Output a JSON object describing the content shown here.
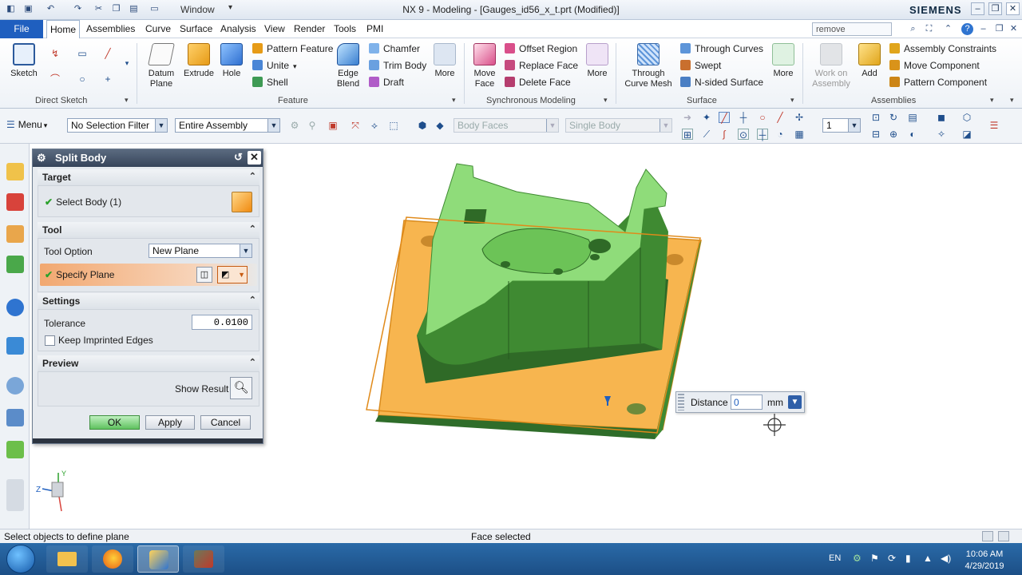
{
  "window": {
    "title": "NX 9 - Modeling - [Gauges_id56_x_t.prt (Modified)]",
    "brand": "SIEMENS",
    "window_menu": "Window",
    "search_value": "remove"
  },
  "menu": {
    "file": "File",
    "tabs": [
      "Home",
      "Assemblies",
      "Curve",
      "Surface",
      "Analysis",
      "View",
      "Render",
      "Tools",
      "PMI"
    ]
  },
  "ribbon": {
    "direct_sketch": {
      "label": "Direct Sketch",
      "sketch": "Sketch"
    },
    "feature": {
      "label": "Feature",
      "datum_plane": "Datum Plane",
      "extrude": "Extrude",
      "hole": "Hole",
      "pattern_feature": "Pattern Feature",
      "unite": "Unite",
      "shell": "Shell",
      "edge_blend": "Edge Blend",
      "chamfer": "Chamfer",
      "trim_body": "Trim Body",
      "draft": "Draft",
      "more": "More"
    },
    "sync": {
      "label": "Synchronous Modeling",
      "move_face": "Move Face",
      "offset_region": "Offset Region",
      "replace_face": "Replace Face",
      "delete_face": "Delete Face",
      "more": "More"
    },
    "surface": {
      "label": "Surface",
      "through_curve_mesh": "Through Curve Mesh",
      "through_curves": "Through Curves",
      "swept": "Swept",
      "n_sided_surface": "N-sided Surface",
      "more": "More"
    },
    "assemblies": {
      "label": "Assemblies",
      "work_on_assembly": "Work on Assembly",
      "add": "Add",
      "assembly_constraints": "Assembly Constraints",
      "move_component": "Move Component",
      "pattern_component": "Pattern Component"
    }
  },
  "toolbar": {
    "menu": "Menu",
    "selection_filter": "No Selection Filter",
    "scope": "Entire Assembly",
    "body_faces": "Body Faces",
    "single_body": "Single Body",
    "layer": "1"
  },
  "dialog": {
    "title": "Split Body",
    "target": {
      "header": "Target",
      "select_body": "Select Body (1)"
    },
    "tool": {
      "header": "Tool",
      "tool_option_label": "Tool Option",
      "tool_option_value": "New Plane",
      "specify_plane": "Specify Plane"
    },
    "settings": {
      "header": "Settings",
      "tolerance_label": "Tolerance",
      "tolerance_value": "0.0100",
      "keep_imprinted": "Keep Imprinted Edges"
    },
    "preview": {
      "header": "Preview",
      "show_result": "Show Result"
    },
    "buttons": {
      "ok": "OK",
      "apply": "Apply",
      "cancel": "Cancel"
    }
  },
  "distance_popup": {
    "label": "Distance",
    "value": "0",
    "unit": "mm"
  },
  "triad": {
    "z": "Z",
    "y": "Y"
  },
  "status": {
    "left": "Select objects to define plane",
    "center": "Face selected"
  },
  "taskbar": {
    "lang": "EN",
    "time": "10:06 AM",
    "date": "4/29/2019"
  },
  "colors": {
    "plate": "#f7b54f",
    "plate_dark": "#d98b1e",
    "body": "#8fdc7a",
    "body_dark": "#3f8a32",
    "accent": "#1f5fbf"
  }
}
